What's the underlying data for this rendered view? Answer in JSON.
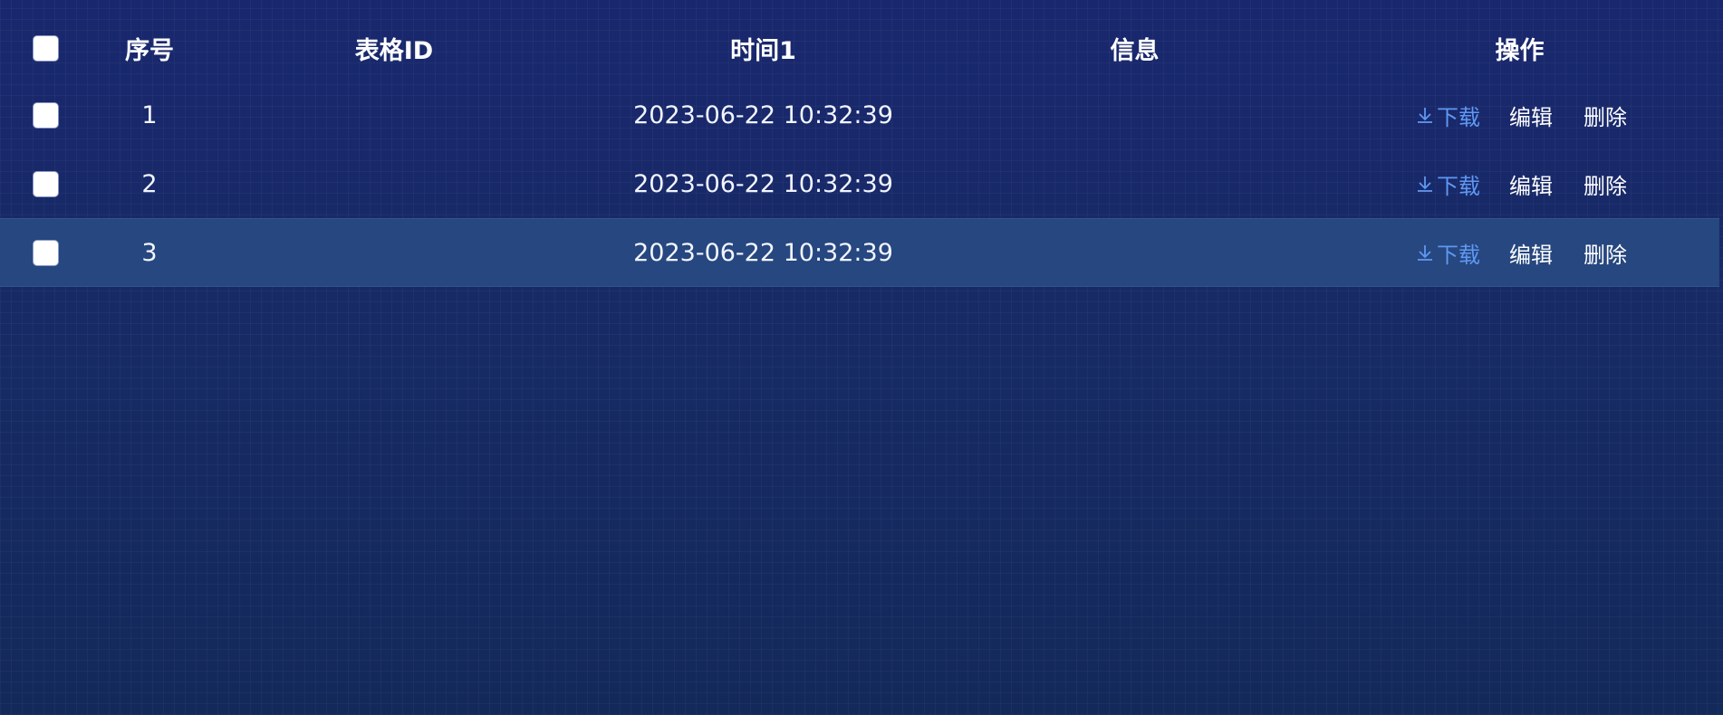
{
  "table": {
    "columns": {
      "index": "序号",
      "table_id": "表格ID",
      "time1": "时间1",
      "info": "信息",
      "actions": "操作"
    },
    "rows": [
      {
        "index": "1",
        "table_id": "",
        "time1": "2023-06-22 10:32:39",
        "info": "",
        "selected": false
      },
      {
        "index": "2",
        "table_id": "",
        "time1": "2023-06-22 10:32:39",
        "info": "",
        "selected": false
      },
      {
        "index": "3",
        "table_id": "",
        "time1": "2023-06-22 10:32:39",
        "info": "",
        "selected": true
      }
    ],
    "actions": {
      "download": "下载",
      "edit": "编辑",
      "delete": "删除"
    },
    "icons": {
      "download": "download-icon"
    }
  },
  "colors": {
    "background": "#172a68",
    "selected_row": "#26477f",
    "download_link": "#5f98f2",
    "text": "#ffffff"
  }
}
